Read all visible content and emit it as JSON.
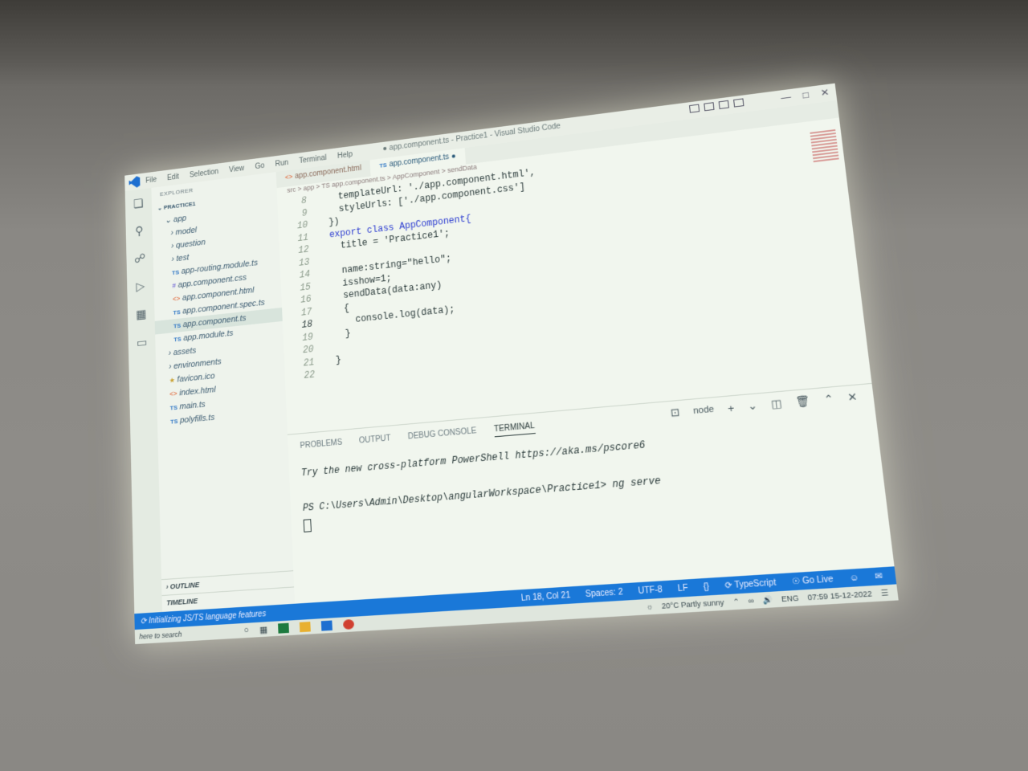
{
  "window": {
    "title": "● app.component.ts - Practice1 - Visual Studio Code",
    "menu": [
      "File",
      "Edit",
      "Selection",
      "View",
      "Go",
      "Run",
      "Terminal",
      "Help"
    ]
  },
  "explorer": {
    "header": "EXPLORER",
    "root": "PRACTICE1",
    "items": [
      {
        "label": "app",
        "kind": "folder-open"
      },
      {
        "label": "model",
        "kind": "folder"
      },
      {
        "label": "question",
        "kind": "folder"
      },
      {
        "label": "test",
        "kind": "folder"
      },
      {
        "label": "app-routing.module.ts",
        "kind": "ts"
      },
      {
        "label": "app.component.css",
        "kind": "css"
      },
      {
        "label": "app.component.html",
        "kind": "html"
      },
      {
        "label": "app.component.spec.ts",
        "kind": "ts"
      },
      {
        "label": "app.component.ts",
        "kind": "ts",
        "selected": true
      },
      {
        "label": "app.module.ts",
        "kind": "ts"
      },
      {
        "label": "assets",
        "kind": "folder"
      },
      {
        "label": "environments",
        "kind": "folder"
      },
      {
        "label": "favicon.ico",
        "kind": "ico"
      },
      {
        "label": "index.html",
        "kind": "html"
      },
      {
        "label": "main.ts",
        "kind": "ts"
      },
      {
        "label": "polyfills.ts",
        "kind": "ts"
      }
    ],
    "outline": "OUTLINE",
    "timeline": "TIMELINE"
  },
  "tabs": [
    {
      "label": "app.component.html"
    },
    {
      "label": "app.component.ts",
      "active": true
    }
  ],
  "breadcrumb": "src > app > TS app.component.ts > AppComponent > sendData",
  "code": [
    {
      "n": "8",
      "text": "    templateUrl: './app.component.html',"
    },
    {
      "n": "9",
      "text": "    styleUrls: ['./app.component.css']"
    },
    {
      "n": "10",
      "text": "  })"
    },
    {
      "n": "11",
      "text": "  export class AppComponent{"
    },
    {
      "n": "12",
      "text": "    title = 'Practice1';"
    },
    {
      "n": "13",
      "text": ""
    },
    {
      "n": "14",
      "text": "    name:string=\"hello\";"
    },
    {
      "n": "15",
      "text": "    isshow=1;"
    },
    {
      "n": "16",
      "text": "    sendData(data:any)"
    },
    {
      "n": "17",
      "text": "    {"
    },
    {
      "n": "18",
      "text": "      console.log(data);"
    },
    {
      "n": "19",
      "text": "    }"
    },
    {
      "n": "20",
      "text": ""
    },
    {
      "n": "21",
      "text": "  }"
    },
    {
      "n": "22",
      "text": ""
    }
  ],
  "panel": {
    "tabs": [
      "PROBLEMS",
      "OUTPUT",
      "DEBUG CONSOLE",
      "TERMINAL"
    ],
    "active_tab": "TERMINAL",
    "shell": "node",
    "lines": [
      "Try the new cross-platform PowerShell https://aka.ms/pscore6",
      "",
      "PS C:\\Users\\Admin\\Desktop\\angularWorkspace\\Practice1> ng serve"
    ]
  },
  "status": {
    "left": "Initializing JS/TS language features",
    "position": "Ln 18, Col 21",
    "spaces": "Spaces: 2",
    "encoding": "UTF-8",
    "eol": "LF",
    "language": "TypeScript",
    "golive": "Go Live"
  },
  "taskbar": {
    "search": "here to search",
    "weather": "20°C  Partly sunny",
    "lang": "ENG",
    "time": "07:59",
    "date": "15-12-2022"
  },
  "colors": {
    "statusbar": "#1a78d8",
    "screen": "#f1f6ee"
  }
}
